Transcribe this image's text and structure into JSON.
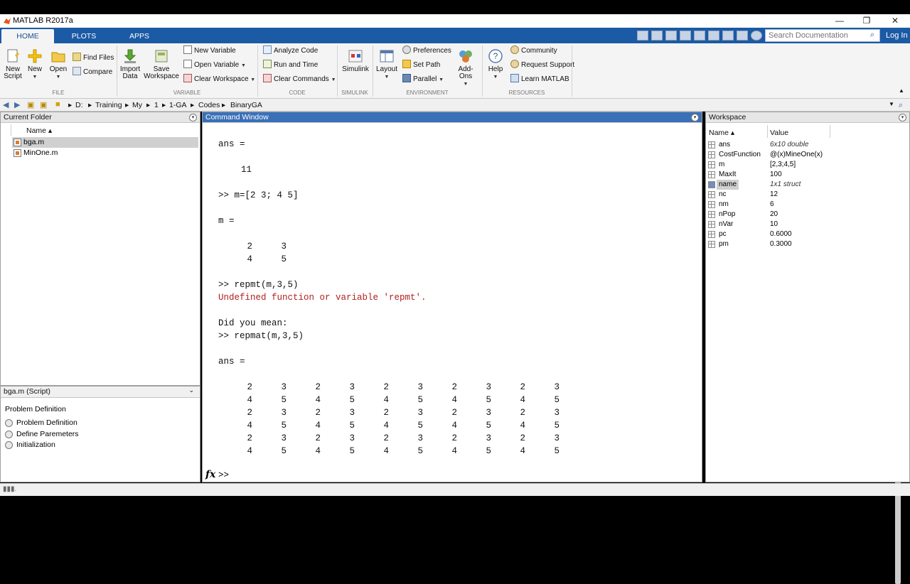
{
  "window": {
    "title": "MATLAB R2017a"
  },
  "tabs": [
    "HOME",
    "PLOTS",
    "APPS"
  ],
  "search": {
    "placeholder": "Search Documentation"
  },
  "login_label": "Log In",
  "ribbon": {
    "file": {
      "new_script": [
        "New",
        "Script"
      ],
      "new": "New",
      "open": "Open",
      "find_files": "Find Files",
      "compare": "Compare",
      "group": "FILE"
    },
    "variable": {
      "import_data": [
        "Import",
        "Data"
      ],
      "save_workspace": [
        "Save",
        "Workspace"
      ],
      "new_variable": "New Variable",
      "open_variable": "Open Variable",
      "clear_workspace": "Clear Workspace",
      "group": "VARIABLE"
    },
    "code": {
      "analyze_code": "Analyze Code",
      "run_and_time": "Run and Time",
      "clear_commands": "Clear Commands",
      "group": "CODE"
    },
    "simulink": {
      "label": "Simulink",
      "group": "SIMULINK"
    },
    "environment": {
      "layout": "Layout",
      "preferences": "Preferences",
      "set_path": "Set Path",
      "parallel": "Parallel",
      "add_ons": "Add-Ons",
      "group": "ENVIRONMENT"
    },
    "resources": {
      "help": "Help",
      "community": "Community",
      "request_support": "Request Support",
      "learn_matlab": "Learn MATLAB",
      "group": "RESOURCES"
    }
  },
  "path": [
    "D:",
    "Training",
    "My",
    "1",
    "1-GA",
    "Codes",
    "BinaryGA"
  ],
  "current_folder": {
    "title": "Current Folder",
    "column": "Name ▴",
    "files": [
      "bga.m",
      "MinOne.m"
    ]
  },
  "details": {
    "title": "bga.m  (Script)",
    "heading": "Problem Definition",
    "items": [
      "Problem Definition",
      "Define Paremeters",
      "Initialization"
    ]
  },
  "command_window": {
    "title": "Command Window",
    "lines": [
      "ans =",
      "11",
      ">> m=[2 3; 4 5]",
      "m =",
      ">> repmt(m,3,5)",
      "Undefined function or variable 'repmt'.",
      "Did you mean:",
      ">> repmat(m,3,5)",
      "ans ="
    ],
    "m_matrix": [
      [
        "2",
        "3"
      ],
      [
        "4",
        "5"
      ]
    ],
    "ans_matrix": [
      [
        "2",
        "3",
        "2",
        "3",
        "2",
        "3",
        "2",
        "3",
        "2",
        "3"
      ],
      [
        "4",
        "5",
        "4",
        "5",
        "4",
        "5",
        "4",
        "5",
        "4",
        "5"
      ],
      [
        "2",
        "3",
        "2",
        "3",
        "2",
        "3",
        "2",
        "3",
        "2",
        "3"
      ],
      [
        "4",
        "5",
        "4",
        "5",
        "4",
        "5",
        "4",
        "5",
        "4",
        "5"
      ],
      [
        "2",
        "3",
        "2",
        "3",
        "2",
        "3",
        "2",
        "3",
        "2",
        "3"
      ],
      [
        "4",
        "5",
        "4",
        "5",
        "4",
        "5",
        "4",
        "5",
        "4",
        "5"
      ]
    ],
    "fx": "fx",
    "prompt": ">>"
  },
  "workspace": {
    "title": "Workspace",
    "columns": [
      "Name ▴",
      "Value"
    ],
    "rows": [
      {
        "name": "ans",
        "value": "6x10 double"
      },
      {
        "name": "CostFunction",
        "value": "@(x)MineOne(x)"
      },
      {
        "name": "m",
        "value": "[2,3;4,5]"
      },
      {
        "name": "MaxIt",
        "value": "100"
      },
      {
        "name": "name",
        "value": "1x1 struct"
      },
      {
        "name": "nc",
        "value": "12"
      },
      {
        "name": "nm",
        "value": "6"
      },
      {
        "name": "nPop",
        "value": "20"
      },
      {
        "name": "nVar",
        "value": "10"
      },
      {
        "name": "pc",
        "value": "0.6000"
      },
      {
        "name": "pm",
        "value": "0.3000"
      }
    ]
  }
}
